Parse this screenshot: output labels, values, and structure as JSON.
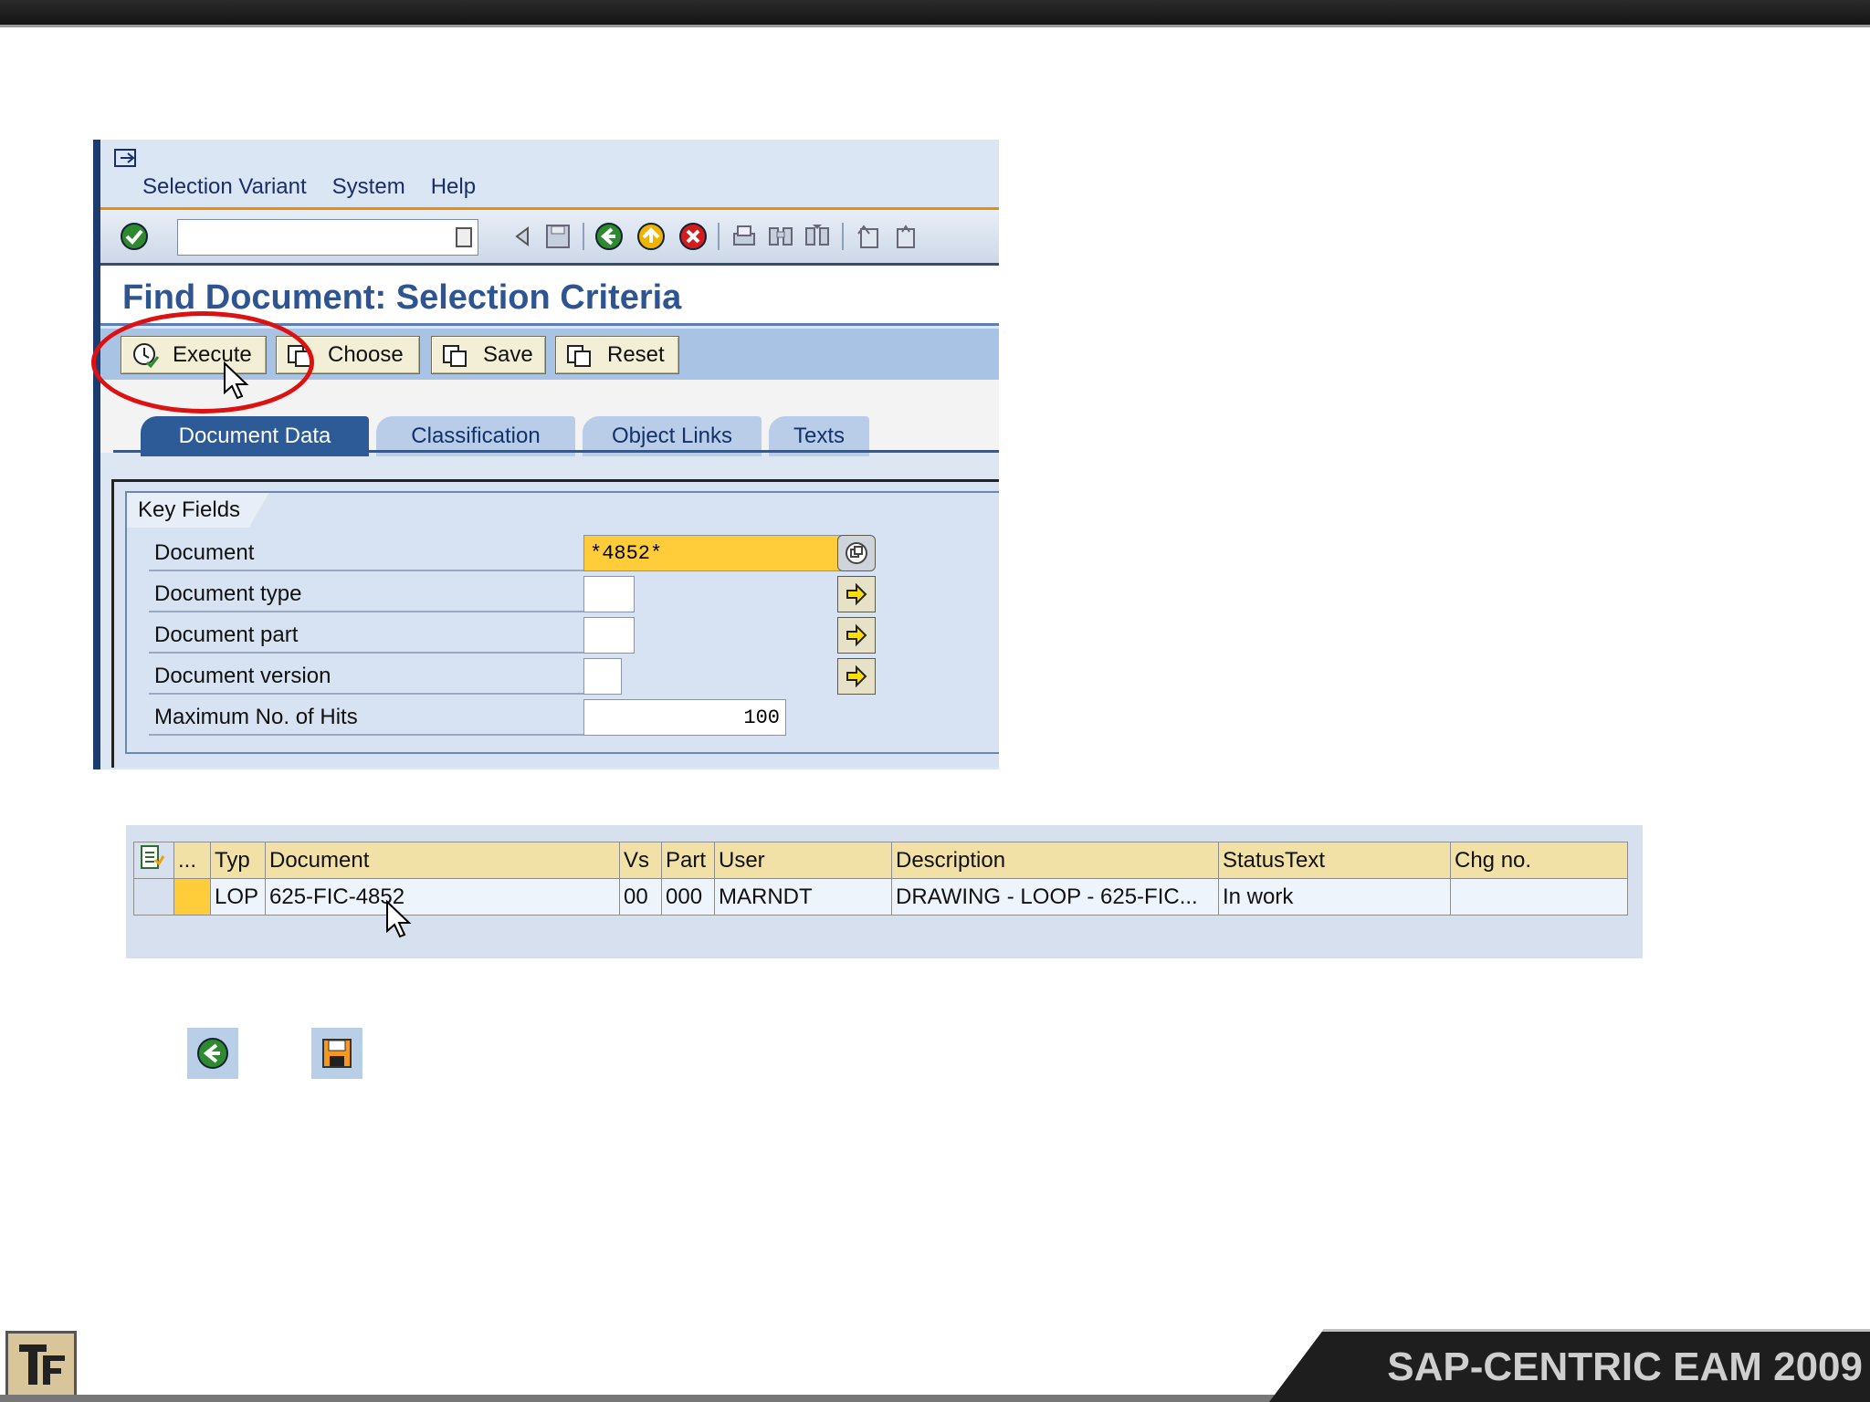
{
  "menu": {
    "items": [
      {
        "label": "Selection Variant"
      },
      {
        "label": "System"
      },
      {
        "label": "Help"
      }
    ]
  },
  "toolbar": {
    "command_value": ""
  },
  "page": {
    "title": "Find Document: Selection Criteria"
  },
  "app_toolbar": {
    "execute": "Execute",
    "choose": "Choose",
    "save": "Save",
    "reset": "Reset"
  },
  "tabs": [
    {
      "label": "Document Data",
      "active": true
    },
    {
      "label": "Classification",
      "active": false
    },
    {
      "label": "Object Links",
      "active": false
    },
    {
      "label": "Texts",
      "active": false
    }
  ],
  "key_fields": {
    "title": "Key Fields",
    "document": {
      "label": "Document",
      "value": "*4852*"
    },
    "document_type": {
      "label": "Document type",
      "value": ""
    },
    "document_part": {
      "label": "Document part",
      "value": ""
    },
    "document_version": {
      "label": "Document version",
      "value": ""
    },
    "max_hits": {
      "label": "Maximum No. of Hits",
      "value": "100"
    }
  },
  "result": {
    "columns": [
      "...",
      "Typ",
      "Document",
      "Vs",
      "Part",
      "User",
      "Description",
      "StatusText",
      "Chg no."
    ],
    "rows": [
      {
        "typ": "LOP",
        "document": "625-FIC-4852",
        "vs": "00",
        "part": "000",
        "user": "MARNDT",
        "description": "DRAWING - LOOP - 625-FIC...",
        "status": "In work",
        "chg": ""
      }
    ]
  },
  "footer": {
    "brand": "SAP-CENTRIC EAM 2009"
  },
  "colors": {
    "accent_orange": "#f08c00",
    "title_blue": "#2e5591",
    "highlight_yellow": "#ffcc3a",
    "annotation_red": "#dd1111"
  }
}
